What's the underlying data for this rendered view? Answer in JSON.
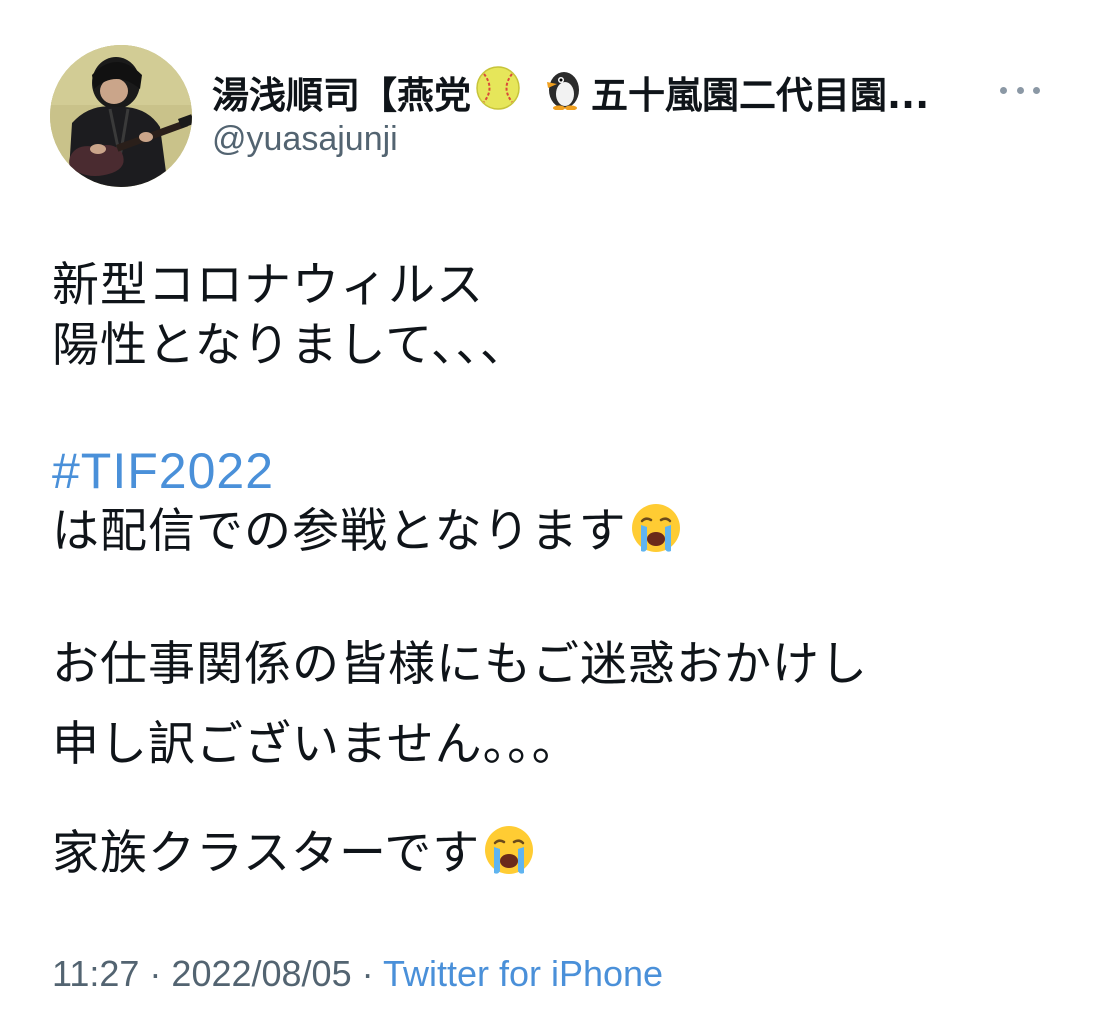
{
  "user": {
    "display_name_part1": "湯浅順司【燕党",
    "display_name_part2": "五十嵐園二代目園...",
    "handle": "@yuasajunji"
  },
  "tweet": {
    "line1": "新型コロナウィルス",
    "line2": "陽性となりまして、、、",
    "hashtag": "#TIF2022",
    "line4": "は配信での参戦となります",
    "line5": "お仕事関係の皆様にもご迷惑おかけし",
    "line6": "申し訳ございません。。。",
    "line7": "家族クラスターです"
  },
  "meta": {
    "time": "11:27",
    "separator1": " · ",
    "date": "2022/08/05",
    "separator2": " · ",
    "source": "Twitter for iPhone"
  },
  "colors": {
    "link": "#4a90d9",
    "secondary_text": "#536471",
    "text": "#0f1419"
  },
  "icons": [
    "softball-icon",
    "penguin-icon",
    "crying-face-icon",
    "more-options-icon"
  ]
}
